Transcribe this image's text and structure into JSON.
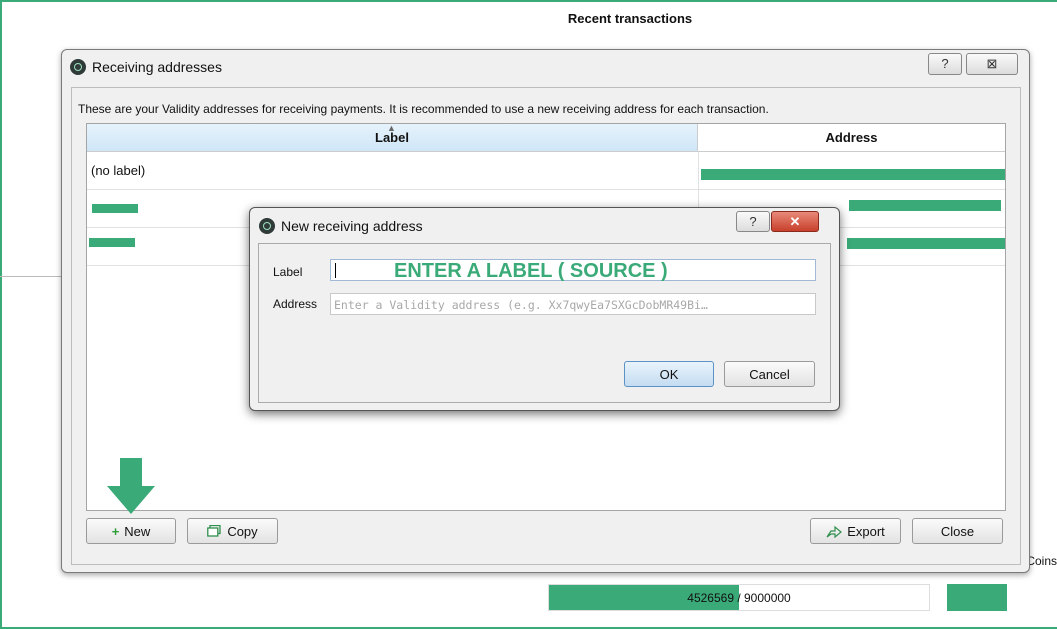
{
  "background": {
    "title": "Recent transactions",
    "coins_label": "Coins",
    "progress_text_highlight": "4526569",
    "progress_text_rest": " / 9000000",
    "progress_fraction": 0.5
  },
  "dialog": {
    "title": "Receiving addresses",
    "help_glyph": "?",
    "close_glyph": "⊠",
    "description": "These are your Validity addresses for receiving payments. It is recommended to use a new receiving address for each transaction.",
    "table": {
      "columns": [
        "Label",
        "Address"
      ],
      "rows": [
        {
          "label": "(no label)"
        },
        {
          "label": ""
        },
        {
          "label": ""
        }
      ]
    },
    "buttons": {
      "new": "New",
      "copy": "Copy",
      "export": "Export",
      "close": "Close"
    }
  },
  "modal": {
    "title": "New receiving address",
    "help_glyph": "?",
    "close_glyph": "✕",
    "label_field_label": "Label",
    "label_field_value": "",
    "overlay_text": "ENTER A LABEL ( SOURCE )",
    "address_field_label": "Address",
    "address_placeholder": "Enter a Validity address (e.g. Xx7qwyEa7SXGcDobMR49Bi…",
    "ok": "OK",
    "cancel": "Cancel"
  },
  "colors": {
    "accent": "#3aaa78",
    "ok_border": "#5c92c4",
    "close_red": "#c7402b"
  },
  "icons": [
    "validity-app-icon",
    "plus-icon",
    "copy-icon",
    "export-icon",
    "green-down-arrow-icon"
  ]
}
